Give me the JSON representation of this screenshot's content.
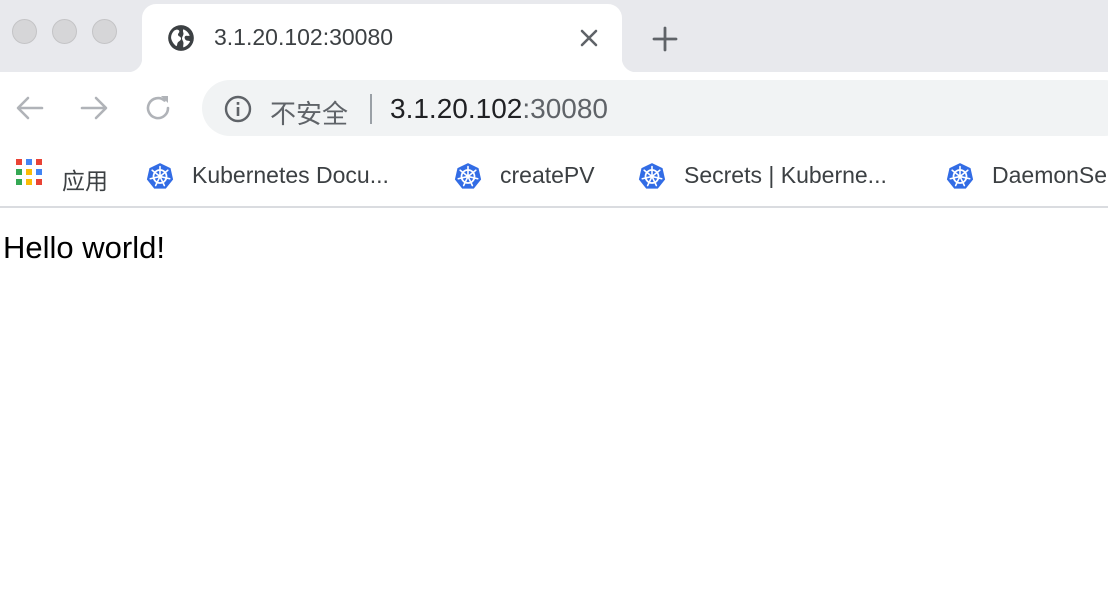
{
  "tab": {
    "title": "3.1.20.102:30080",
    "favicon": "globe-icon"
  },
  "toolbar": {
    "back": "arrow-left-icon",
    "forward": "arrow-right-icon",
    "reload": "reload-icon"
  },
  "omnibox": {
    "security_label": "不安全",
    "url_host": "3.1.20.102",
    "url_port": ":30080"
  },
  "bookmarks": [
    {
      "label": "应用",
      "icon": "apps-grid-icon"
    },
    {
      "label": "Kubernetes Docu...",
      "icon": "kubernetes-icon"
    },
    {
      "label": "createPV",
      "icon": "kubernetes-icon"
    },
    {
      "label": "Secrets | Kuberne...",
      "icon": "kubernetes-icon"
    },
    {
      "label": "DaemonSe",
      "icon": "kubernetes-icon"
    }
  ],
  "page": {
    "text": "Hello world!"
  },
  "colors": {
    "tabstrip": "#e8e9ed",
    "omnibox": "#f1f3f4",
    "kubernetes_blue": "#326ce5"
  }
}
